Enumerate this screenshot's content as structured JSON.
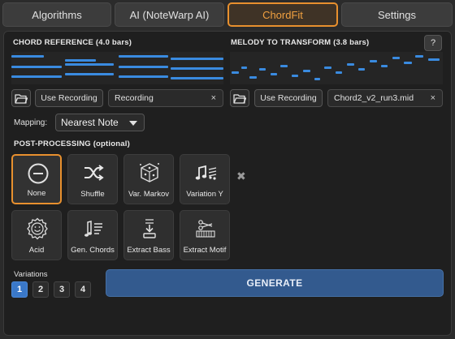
{
  "tabs": [
    {
      "label": "Algorithms",
      "active": false
    },
    {
      "label": "AI (NoteWarp AI)",
      "active": false
    },
    {
      "label": "ChordFit",
      "active": true
    },
    {
      "label": "Settings",
      "active": false
    }
  ],
  "chord_reference": {
    "title": "CHORD REFERENCE (4.0 bars)",
    "use_recording_label": "Use Recording",
    "field_value": "Recording",
    "clear_glyph": "×"
  },
  "melody": {
    "title": "MELODY TO TRANSFORM (3.8 bars)",
    "help_label": "?",
    "use_recording_label": "Use Recording",
    "field_value": "Chord2_v2_run3.mid",
    "clear_glyph": "×"
  },
  "mapping": {
    "label": "Mapping:",
    "value": "Nearest Note"
  },
  "post_processing": {
    "title": "POST-PROCESSING (optional)",
    "remove_glyph": "✖",
    "options": [
      {
        "label": "None",
        "icon": "minus-circle-icon",
        "active": true
      },
      {
        "label": "Shuffle",
        "icon": "shuffle-icon",
        "active": false
      },
      {
        "label": "Var. Markov",
        "icon": "markov-cube-icon",
        "active": false
      },
      {
        "label": "Variation Y",
        "icon": "music-notes-icon",
        "active": false
      },
      {
        "label": "Acid",
        "icon": "acid-smiley-icon",
        "active": false
      },
      {
        "label": "Gen. Chords",
        "icon": "chord-notes-icon",
        "active": false
      },
      {
        "label": "Extract Bass",
        "icon": "extract-bass-icon",
        "active": false
      },
      {
        "label": "Extract Motif",
        "icon": "extract-motif-icon",
        "active": false
      }
    ]
  },
  "variations": {
    "label": "Variations",
    "options": [
      "1",
      "2",
      "3",
      "4"
    ],
    "selected": "1"
  },
  "generate_label": "GENERATE",
  "colors": {
    "accent": "#e8902e",
    "note": "#3a8be0",
    "selected": "#3a78c8",
    "generate": "#335a8e"
  }
}
